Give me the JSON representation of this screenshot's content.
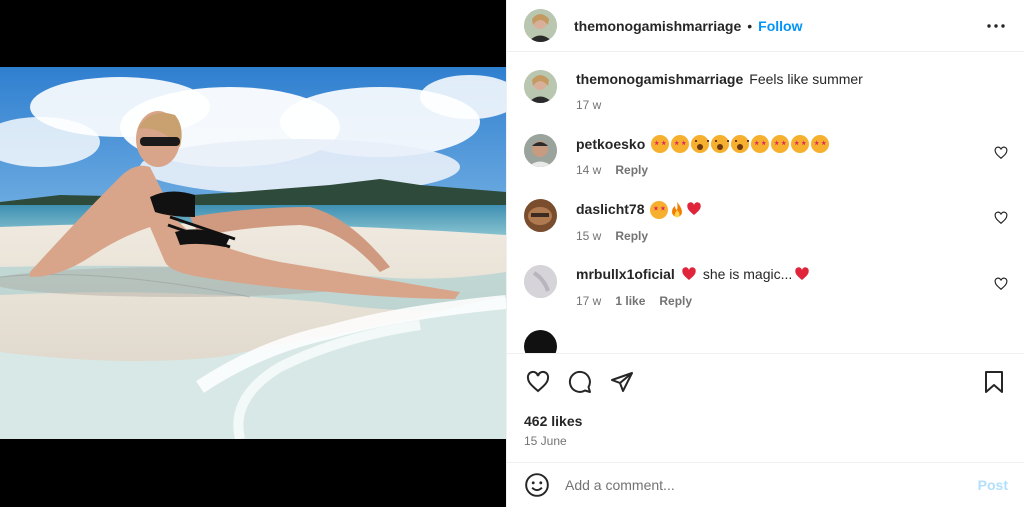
{
  "post": {
    "author": "themonogamishmarriage",
    "separator": "•",
    "follow_label": "Follow",
    "photo_description": "woman-on-beach-photo"
  },
  "caption": {
    "user": "themonogamishmarriage",
    "text": "Feels like summer",
    "time": "17 w"
  },
  "comments": [
    {
      "user": "petkoesko",
      "emojis": [
        "star",
        "star",
        "wow",
        "wow",
        "wow",
        "star",
        "star",
        "star",
        "star"
      ],
      "text": "",
      "time": "14 w",
      "likes": "",
      "reply_label": "Reply"
    },
    {
      "user": "daslicht78",
      "emojis": [
        "star",
        "fire",
        "heart"
      ],
      "text": "",
      "time": "15 w",
      "likes": "",
      "reply_label": "Reply"
    },
    {
      "user": "mrbullx1oficial",
      "emojis_pre": [
        "heart"
      ],
      "text": "she is magic...",
      "emojis_post": [
        "heart"
      ],
      "time": "17 w",
      "likes": "1 like",
      "reply_label": "Reply"
    }
  ],
  "stats": {
    "likes": "462 likes",
    "date": "15 June"
  },
  "composer": {
    "placeholder": "Add a comment...",
    "post_label": "Post"
  },
  "colors": {
    "link_blue": "#0095f6",
    "post_disabled": "#b2dffc",
    "muted": "#737373"
  }
}
